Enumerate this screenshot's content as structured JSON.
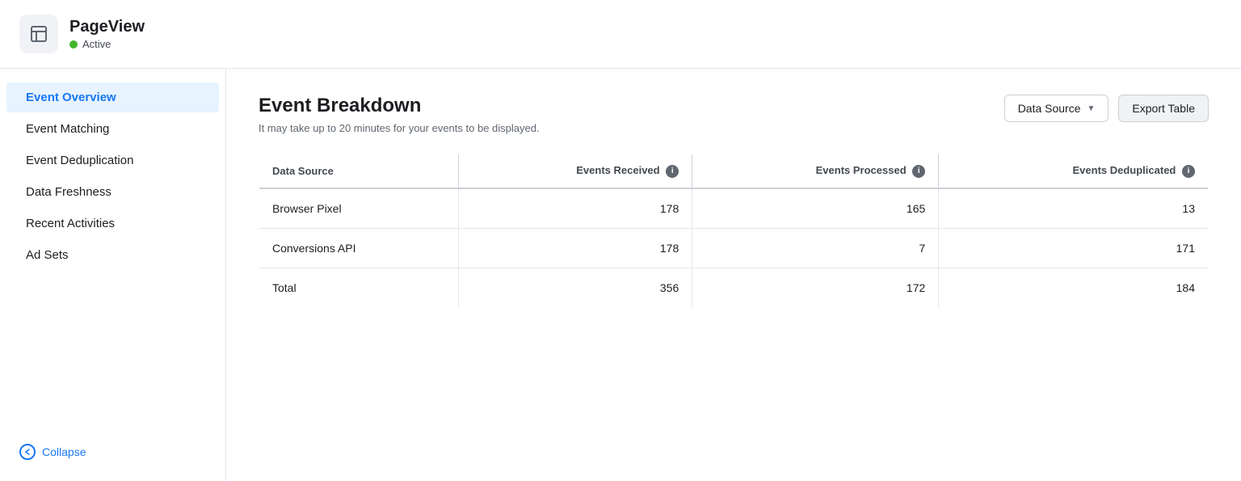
{
  "header": {
    "icon_label": "layout-icon",
    "title": "PageView",
    "status_label": "Active",
    "status_color": "#42b72a"
  },
  "sidebar": {
    "items": [
      {
        "id": "event-overview",
        "label": "Event Overview",
        "active": true
      },
      {
        "id": "event-matching",
        "label": "Event Matching",
        "active": false
      },
      {
        "id": "event-deduplication",
        "label": "Event Deduplication",
        "active": false
      },
      {
        "id": "data-freshness",
        "label": "Data Freshness",
        "active": false
      },
      {
        "id": "recent-activities",
        "label": "Recent Activities",
        "active": false
      },
      {
        "id": "ad-sets",
        "label": "Ad Sets",
        "active": false
      }
    ],
    "collapse_label": "Collapse"
  },
  "content": {
    "title": "Event Breakdown",
    "subtitle": "It may take up to 20 minutes for your events to be displayed.",
    "datasource_dropdown_label": "Data Source",
    "export_button_label": "Export Table",
    "table": {
      "columns": [
        {
          "id": "data-source",
          "label": "Data Source",
          "align": "left",
          "info": false
        },
        {
          "id": "events-received",
          "label": "Events Received",
          "align": "right",
          "info": true
        },
        {
          "id": "events-processed",
          "label": "Events Processed",
          "align": "right",
          "info": true
        },
        {
          "id": "events-deduplicated",
          "label": "Events Deduplicated",
          "align": "right",
          "info": true
        }
      ],
      "rows": [
        {
          "data_source": "Browser Pixel",
          "events_received": "178",
          "events_processed": "165",
          "events_deduplicated": "13"
        },
        {
          "data_source": "Conversions API",
          "events_received": "178",
          "events_processed": "7",
          "events_deduplicated": "171"
        },
        {
          "data_source": "Total",
          "events_received": "356",
          "events_processed": "172",
          "events_deduplicated": "184"
        }
      ]
    }
  }
}
